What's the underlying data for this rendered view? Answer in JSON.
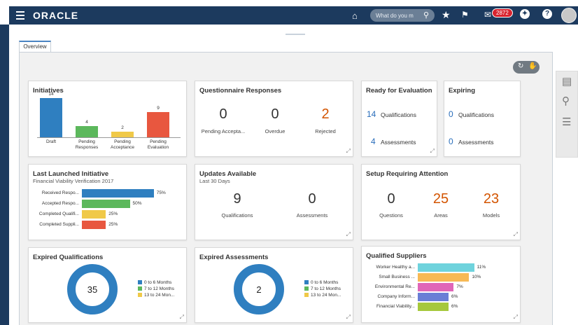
{
  "topbar": {
    "logo": "ORACLE",
    "search_placeholder": "What do you m",
    "notification_count": "2872",
    "colors": {
      "bar": "#1c3a5e",
      "badge": "#d9232e"
    }
  },
  "tabs": [
    {
      "label": "Overview"
    }
  ],
  "cards": {
    "initiatives": {
      "title": "Initiatives",
      "bars": [
        {
          "label": "Draft",
          "value": "14",
          "color": "#2f7fc0"
        },
        {
          "label": "Pending Responses",
          "value": "4",
          "color": "#5cb85c"
        },
        {
          "label": "Pending Acceptance",
          "value": "2",
          "color": "#f0c948"
        },
        {
          "label": "Pending Evaluation",
          "value": "9",
          "color": "#e8573f"
        }
      ]
    },
    "questionnaire": {
      "title": "Questionnaire Responses",
      "items": [
        {
          "value": "0",
          "label": "Pending Accepta..."
        },
        {
          "value": "0",
          "label": "Overdue"
        },
        {
          "value": "2",
          "label": "Rejected"
        }
      ]
    },
    "ready": {
      "title": "Ready for Evaluation",
      "items": [
        {
          "value": "14",
          "label": "Qualifications"
        },
        {
          "value": "4",
          "label": "Assessments"
        }
      ]
    },
    "expiring": {
      "title": "Expiring",
      "items": [
        {
          "value": "0",
          "label": "Qualifications"
        },
        {
          "value": "0",
          "label": "Assessments"
        }
      ]
    },
    "last_launched": {
      "title": "Last Launched Initiative",
      "subtitle": "Financial Viability Verification 2017",
      "bars": [
        {
          "label": "Received Respo...",
          "value": 75,
          "text": "75%",
          "color": "#2f7fc0"
        },
        {
          "label": "Accepted Respo...",
          "value": 50,
          "text": "50%",
          "color": "#5cb85c"
        },
        {
          "label": "Completed Qualifi...",
          "value": 25,
          "text": "25%",
          "color": "#f0c948"
        },
        {
          "label": "Completed Suppli...",
          "value": 25,
          "text": "25%",
          "color": "#e8573f"
        }
      ]
    },
    "updates": {
      "title": "Updates Available",
      "subtitle": "Last 30 Days",
      "items": [
        {
          "value": "9",
          "label": "Qualifications"
        },
        {
          "value": "0",
          "label": "Assessments"
        }
      ]
    },
    "setup": {
      "title": "Setup Requiring Attention",
      "items": [
        {
          "value": "0",
          "label": "Questions"
        },
        {
          "value": "25",
          "label": "Areas"
        },
        {
          "value": "23",
          "label": "Models"
        }
      ]
    },
    "expired_qual": {
      "title": "Expired Qualifications",
      "total": "35",
      "legend": [
        {
          "label": "0 to 6 Months",
          "color": "#2f7fc0"
        },
        {
          "label": "7 to 12 Months",
          "color": "#5cb85c"
        },
        {
          "label": "13 to 24 Mon...",
          "color": "#f0c948"
        }
      ]
    },
    "expired_assess": {
      "title": "Expired Assessments",
      "total": "2",
      "legend": [
        {
          "label": "0 to 6 Months",
          "color": "#2f7fc0"
        },
        {
          "label": "7 to 12 Months",
          "color": "#5cb85c"
        },
        {
          "label": "13 to 24 Mon...",
          "color": "#f0c948"
        }
      ]
    },
    "qualified_suppliers": {
      "title": "Qualified Suppliers",
      "bars": [
        {
          "label": "Worker Healthy a...",
          "value": 11,
          "text": "11%",
          "color": "#6fd3dd"
        },
        {
          "label": "Small Business ...",
          "value": 10,
          "text": "10%",
          "color": "#f7b955"
        },
        {
          "label": "Environmental Re...",
          "value": 7,
          "text": "7%",
          "color": "#e066b8"
        },
        {
          "label": "Company Inform...",
          "value": 6,
          "text": "6%",
          "color": "#6a7ed6"
        },
        {
          "label": "Financial Viability...",
          "value": 6,
          "text": "6%",
          "color": "#a6c83c"
        }
      ]
    }
  }
}
